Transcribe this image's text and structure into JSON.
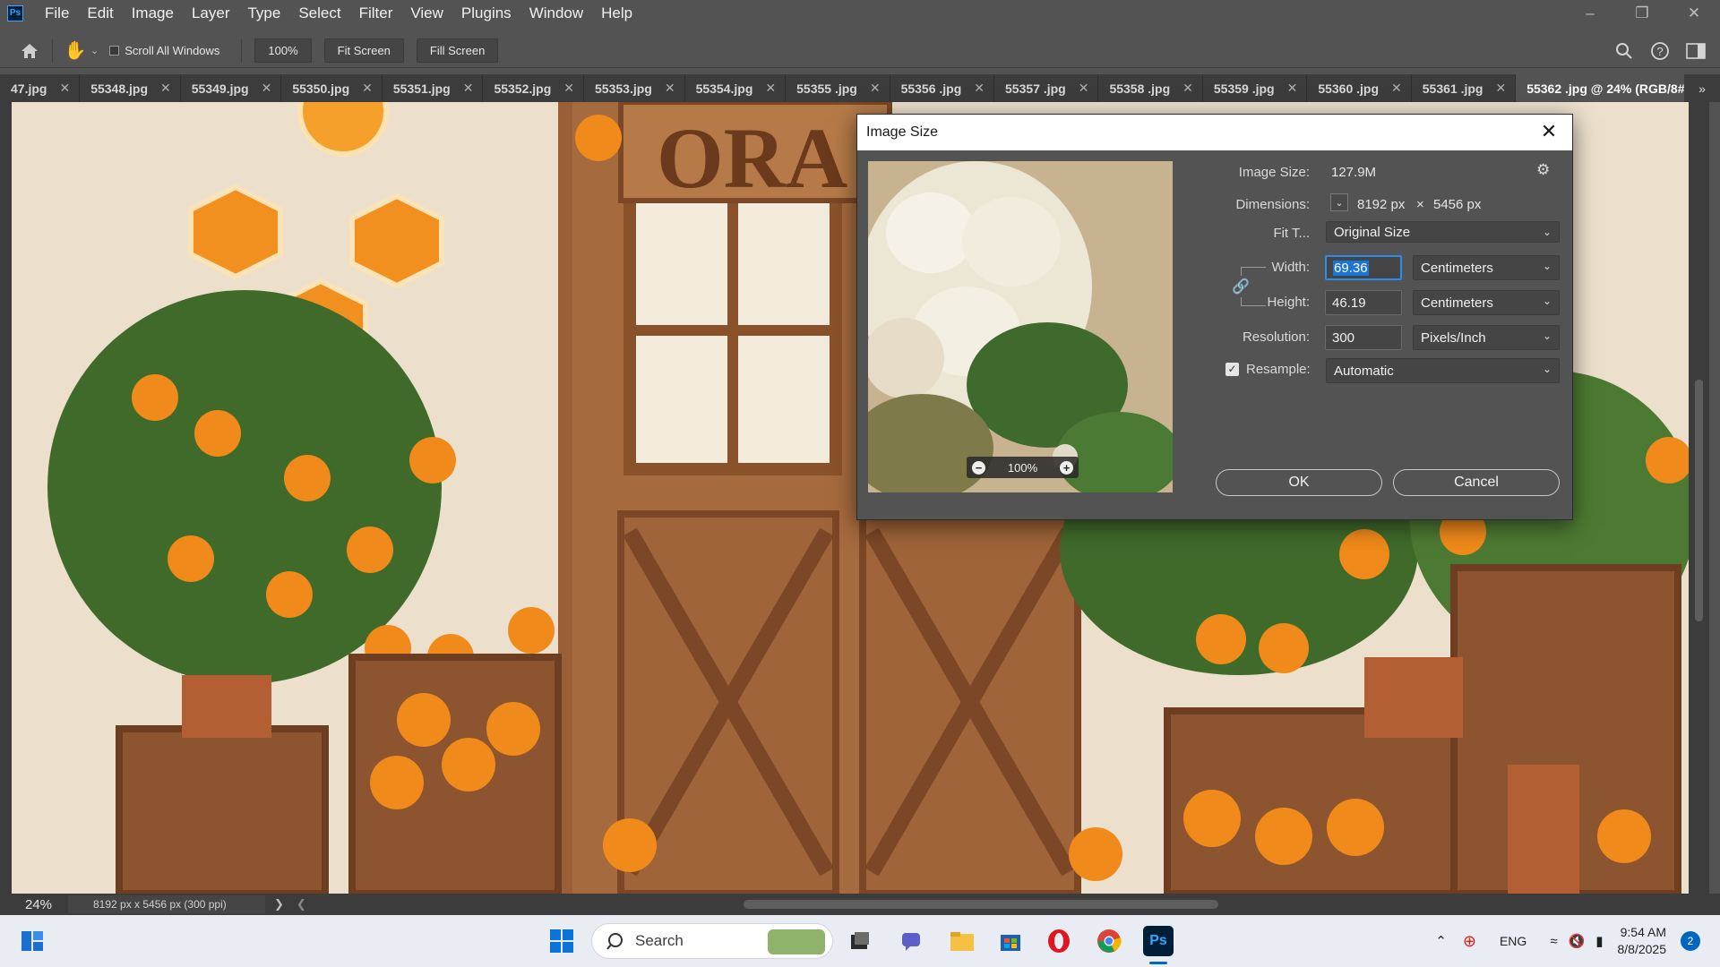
{
  "app": {
    "logo": "Ps"
  },
  "menu": [
    "File",
    "Edit",
    "Image",
    "Layer",
    "Type",
    "Select",
    "Filter",
    "View",
    "Plugins",
    "Window",
    "Help"
  ],
  "options_bar": {
    "scroll_all_windows": "Scroll All Windows",
    "zoom_value": "100%",
    "fit_screen": "Fit Screen",
    "fill_screen": "Fill Screen"
  },
  "tabs": [
    {
      "label": "47.jpg",
      "active": false
    },
    {
      "label": "55348.jpg",
      "active": false
    },
    {
      "label": "55349.jpg",
      "active": false
    },
    {
      "label": "55350.jpg",
      "active": false
    },
    {
      "label": "55351.jpg",
      "active": false
    },
    {
      "label": "55352.jpg",
      "active": false
    },
    {
      "label": "55353.jpg",
      "active": false
    },
    {
      "label": "55354.jpg",
      "active": false
    },
    {
      "label": "55355 .jpg",
      "active": false
    },
    {
      "label": "55356 .jpg",
      "active": false
    },
    {
      "label": "55357 .jpg",
      "active": false
    },
    {
      "label": "55358 .jpg",
      "active": false
    },
    {
      "label": "55359 .jpg",
      "active": false
    },
    {
      "label": "55360 .jpg",
      "active": false
    },
    {
      "label": "55361 .jpg",
      "active": false
    },
    {
      "label": "55362 .jpg @ 24% (RGB/8#)",
      "active": true
    }
  ],
  "canvas": {
    "sign_text": "ORA"
  },
  "status": {
    "zoom": "24%",
    "doc_info": "8192 px x 5456 px (300 ppi)"
  },
  "dialog": {
    "title": "Image Size",
    "image_size_label": "Image Size:",
    "image_size_value": "127.9M",
    "dimensions_label": "Dimensions:",
    "dim_width": "8192 px",
    "dim_times": "×",
    "dim_height": "5456 px",
    "fit_label": "Fit T...",
    "fit_value": "Original Size",
    "width_label": "Width:",
    "width_value": "69.36",
    "width_unit": "Centimeters",
    "height_label": "Height:",
    "height_value": "46.19",
    "height_unit": "Centimeters",
    "resolution_label": "Resolution:",
    "resolution_value": "300",
    "resolution_unit": "Pixels/Inch",
    "resample_label": "Resample:",
    "resample_checked": true,
    "resample_value": "Automatic",
    "preview_zoom": "100%",
    "ok": "OK",
    "cancel": "Cancel"
  },
  "taskbar": {
    "search_placeholder": "Search",
    "language": "ENG",
    "time": "9:54 AM",
    "date": "8/8/2025",
    "notification_count": "2"
  },
  "colors": {
    "accent": "#2d8ceb",
    "ps_blue": "#31a8ff",
    "panel": "#535353",
    "tab_bg": "#3c3c3c"
  }
}
